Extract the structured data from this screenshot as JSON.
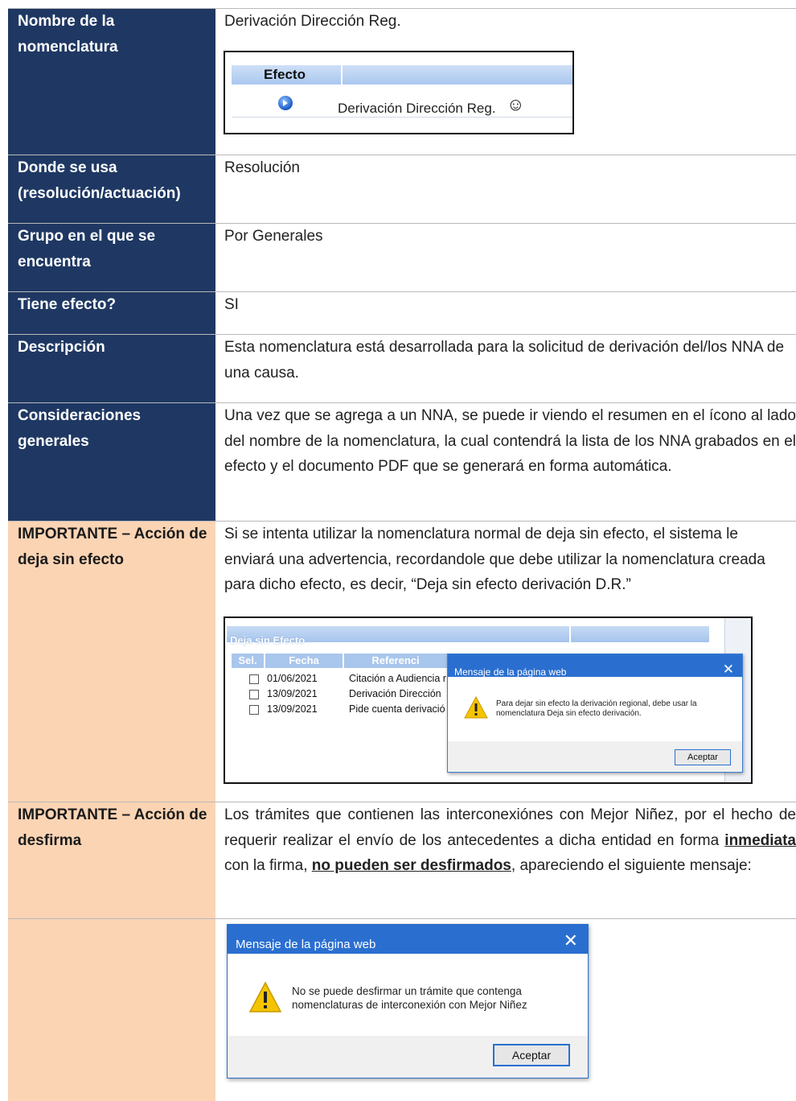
{
  "rows": [
    {
      "label": "Nombre de la nomenclatura",
      "value": "Derivación Dirección Reg."
    },
    {
      "label": "Donde se usa (resolución/actuación)",
      "value": "Resolución"
    },
    {
      "label": "Grupo en el que se encuentra",
      "value": "Por Generales"
    },
    {
      "label": "Tiene efecto?",
      "value": "SI"
    },
    {
      "label": "Descripción",
      "value": "Esta nomenclatura está desarrollada para la solicitud de derivación del/los NNA de una causa."
    },
    {
      "label": "Consideraciones generales",
      "value": "Una vez que se agrega a un NNA, se puede ir viendo el resumen en el ícono al lado del nombre de la nomenclatura, la cual contendrá la lista de los NNA grabados en el efecto y el documento PDF que se generará en forma automática."
    },
    {
      "label": "IMPORTANTE – Acción de deja sin efecto",
      "value": "Si se intenta utilizar la nomenclatura normal de deja sin efecto, el sistema le enviará una advertencia, recordandole que debe utilizar la nomenclatura creada para dicho efecto, es decir, “Deja sin efecto derivación D.R.”"
    },
    {
      "label": "IMPORTANTE – Acción de desfirma",
      "value_before": "Los trámites que contienen las interconexiónes con Mejor Niñez, por el hecho de requerir realizar el envío de los antecedentes a dicha entidad en forma ",
      "value_u1": "inmediata",
      "value_mid": " con la firma, ",
      "value_u2": "no pueden ser desfirmados",
      "value_after": ", apareciendo el siguiente mensaje:"
    }
  ],
  "efecto_table": {
    "header": "Efecto",
    "row_text": "Derivación Dirección Reg.",
    "smile": "☺"
  },
  "shot1": {
    "title": "Deja sin Efecto",
    "headers": [
      "Sel.",
      "Fecha",
      "Referenci"
    ],
    "rows": [
      {
        "fecha": "01/06/2021",
        "ref": "Citación a Audiencia r"
      },
      {
        "fecha": "13/09/2021",
        "ref": "Derivación Dirección"
      },
      {
        "fecha": "13/09/2021",
        "ref": "Pide cuenta derivació"
      }
    ],
    "dialog_title": "Mensaje de la página web",
    "dialog_msg": "Para dejar sin efecto la derivación regional, debe usar la nomenclatura Deja sin efecto derivación.",
    "dialog_button": "Aceptar",
    "close": "✕"
  },
  "shot2": {
    "dialog_title": "Mensaje de la página web",
    "dialog_msg": "No se puede desfirmar un trámite que contenga nomenclaturas de interconexión con Mejor Niñez",
    "dialog_button": "Aceptar",
    "close": "✕"
  },
  "colors": {
    "label_blue": "#1f3863",
    "label_peach": "#fbd4b4",
    "dialog_blue": "#2a6fd0"
  }
}
